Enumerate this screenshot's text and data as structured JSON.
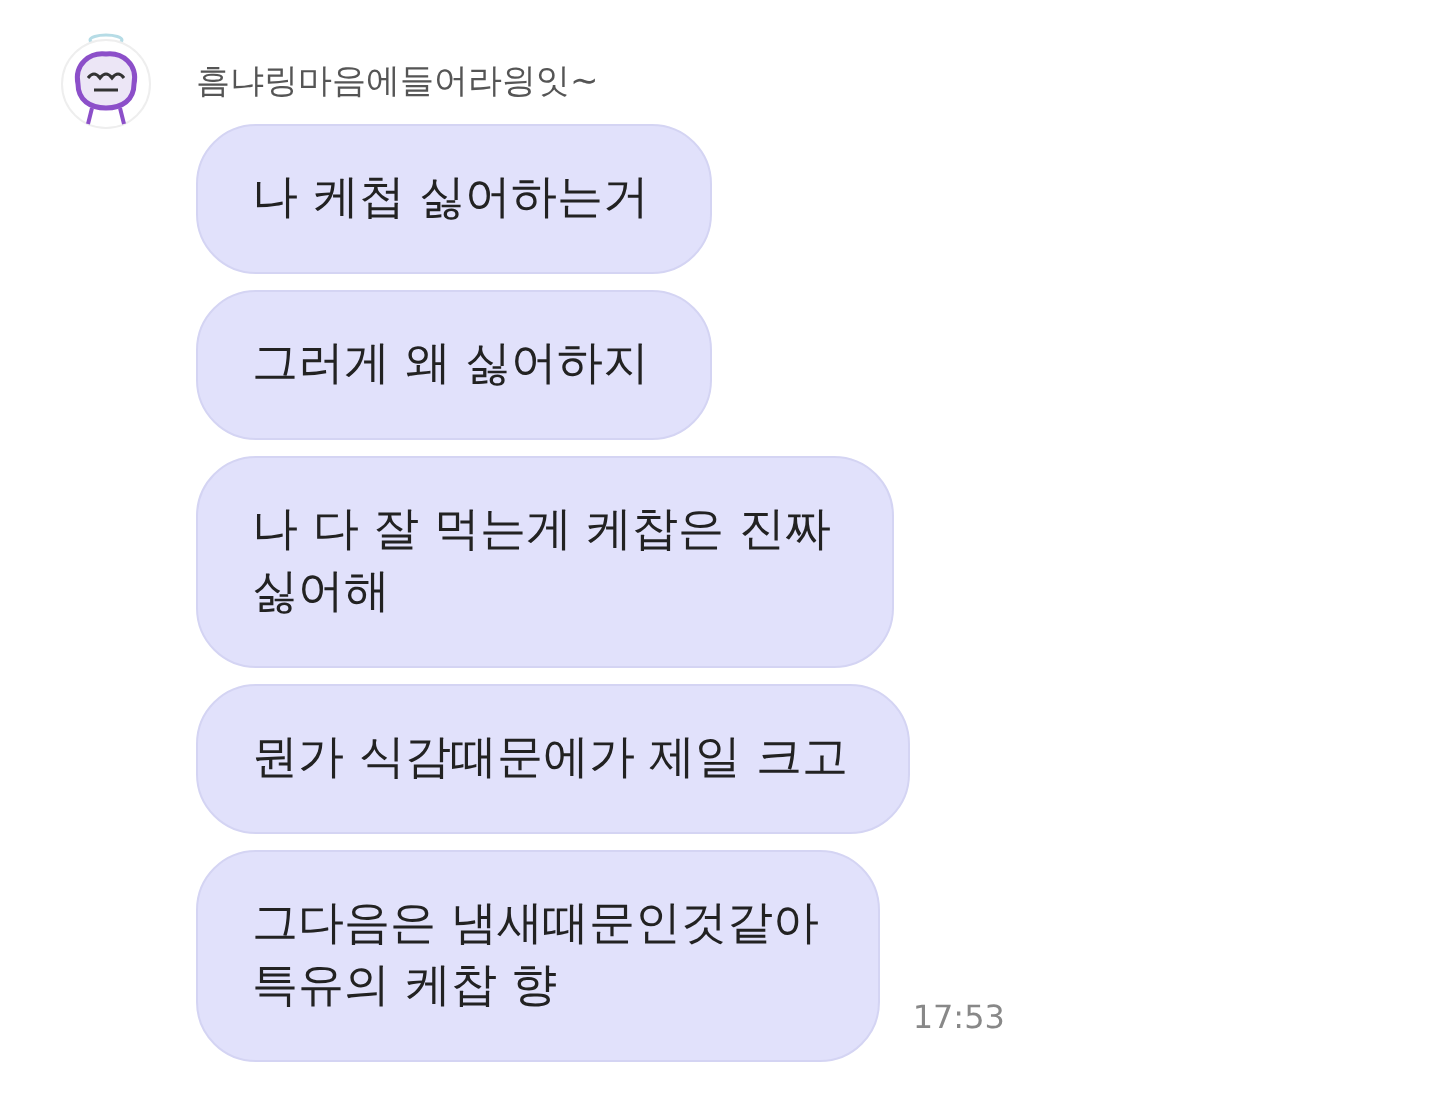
{
  "sender": {
    "name": "흠냐링마음에들어라읭잇~"
  },
  "messages": [
    {
      "text": "나 케첩 싫어하는거"
    },
    {
      "text": "그러게 왜 싫어하지"
    },
    {
      "text": "나 다 잘 먹는게 케찹은 진짜\n싫어해"
    },
    {
      "text": "뭔가 식감때문에가 제일 크고"
    },
    {
      "text": "그다음은 냄새때문인것같아\n특유의 케찹 향",
      "time": "17:53"
    }
  ]
}
